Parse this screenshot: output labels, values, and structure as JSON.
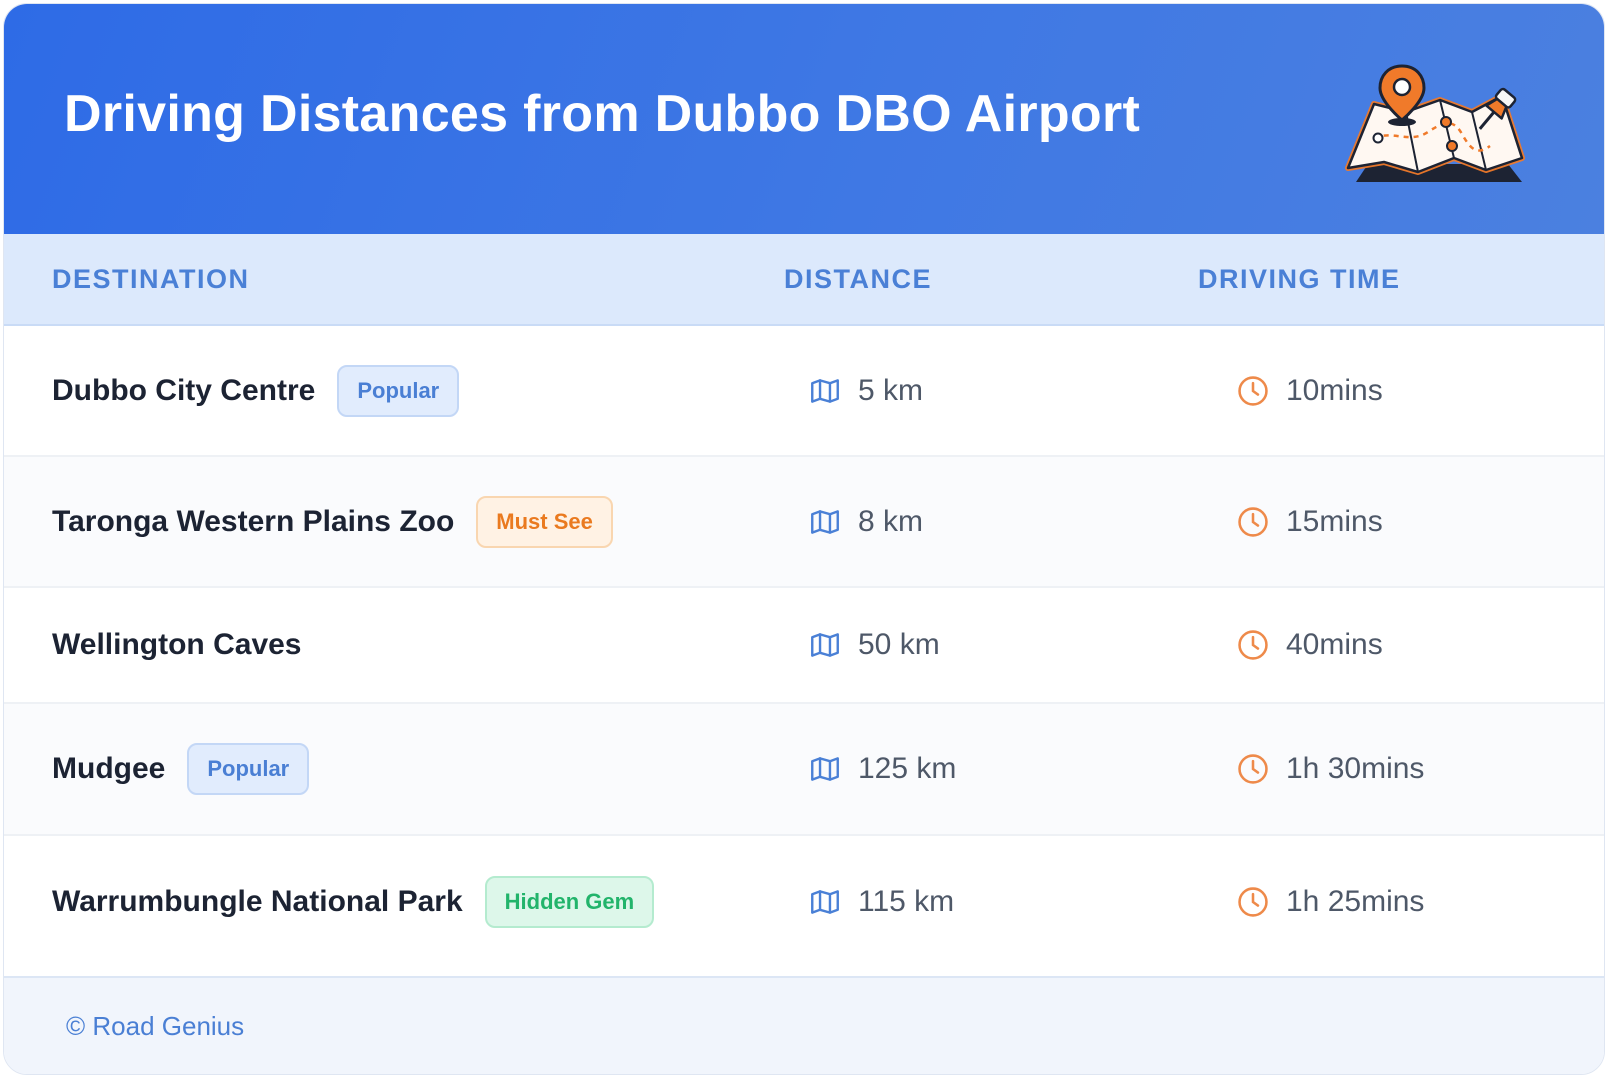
{
  "header": {
    "title": "Driving Distances from Dubbo DBO Airport",
    "illustration": "map-with-pins-icon"
  },
  "table": {
    "columns": [
      "DESTINATION",
      "DISTANCE",
      "DRIVING TIME"
    ],
    "rows": [
      {
        "destination": "Dubbo City Centre",
        "badge": "Popular",
        "badge_style": "blue",
        "distance": "5 km",
        "time": "10mins"
      },
      {
        "destination": "Taronga Western Plains Zoo",
        "badge": "Must See",
        "badge_style": "orange",
        "distance": "8 km",
        "time": "15mins"
      },
      {
        "destination": "Wellington Caves",
        "badge": "",
        "badge_style": "",
        "distance": "50 km",
        "time": "40mins"
      },
      {
        "destination": "Mudgee",
        "badge": "Popular",
        "badge_style": "blue",
        "distance": "125 km",
        "time": "1h 30mins"
      },
      {
        "destination": "Warrumbungle National Park",
        "badge": "Hidden Gem",
        "badge_style": "green",
        "distance": "115 km",
        "time": "1h 25mins"
      }
    ],
    "distance_icon": "map-icon",
    "time_icon": "clock-icon"
  },
  "footer": {
    "text": "© Road Genius"
  },
  "colors": {
    "header_gradient_start": "#2e6be6",
    "header_gradient_end": "#4b80e0",
    "column_header_text": "#4a80d6",
    "map_icon": "#4a80d6",
    "clock_icon": "#ee8a4a"
  }
}
